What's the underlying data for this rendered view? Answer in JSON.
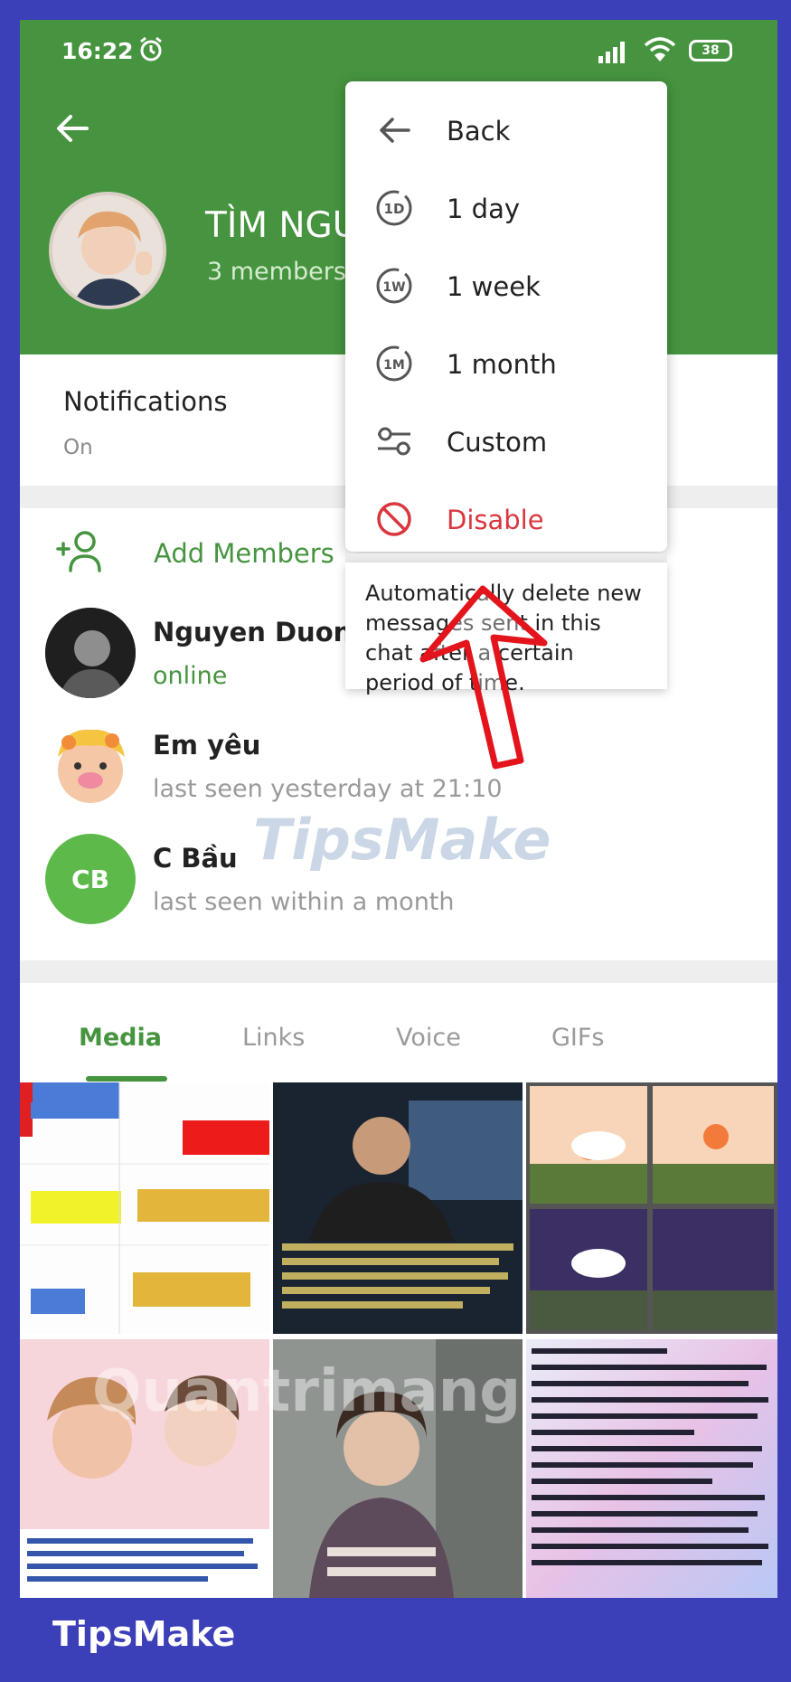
{
  "status_bar": {
    "time": "16:22",
    "battery": "38"
  },
  "group": {
    "title": "TÌM NGƯỜ",
    "subtitle": "3 members"
  },
  "notifications": {
    "title": "Notifications",
    "value": "On"
  },
  "add_members_label": "Add Members",
  "members": [
    {
      "name": "Nguyen Duong",
      "status": "online"
    },
    {
      "name": "Em yêu",
      "status": "last seen yesterday at 21:10"
    },
    {
      "name": "C Bầu",
      "status": "last seen within a month",
      "initials": "CB"
    }
  ],
  "tabs": [
    "Media",
    "Links",
    "Voice",
    "GIFs"
  ],
  "menu": {
    "items": [
      {
        "label": "Back",
        "icon": "arrow-left-icon"
      },
      {
        "label": "1 day",
        "icon": "timer-1d-icon",
        "badge": "1D"
      },
      {
        "label": "1 week",
        "icon": "timer-1w-icon",
        "badge": "1W"
      },
      {
        "label": "1 month",
        "icon": "timer-1m-icon",
        "badge": "1M"
      },
      {
        "label": "Custom",
        "icon": "sliders-icon"
      },
      {
        "label": "Disable",
        "icon": "block-icon"
      }
    ],
    "info": "Automatically delete new messages sent in this chat after a certain period of time."
  },
  "watermarks": {
    "tipsmake": "TipsMake",
    "quantrimang": "Quantrimang"
  },
  "footer_brand": "TipsMake",
  "colors": {
    "header": "#46943f",
    "accent": "#46943f",
    "danger": "#d9363e",
    "frame": "#3b3fb8"
  }
}
